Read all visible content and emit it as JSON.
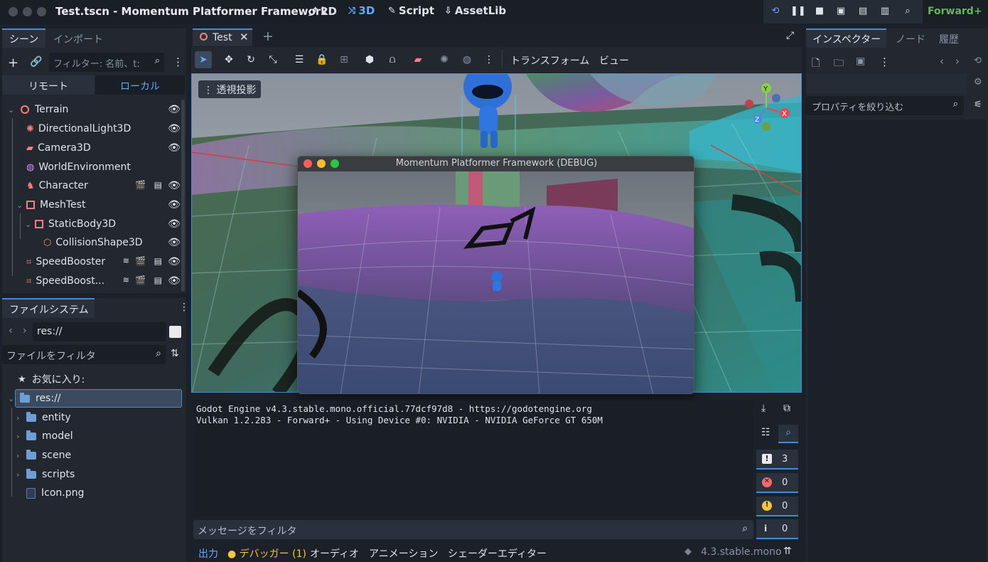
{
  "window": {
    "title": "Test.tscn - Momentum Platformer Framework"
  },
  "modes": [
    {
      "label": "2D",
      "icon": "2d-icon"
    },
    {
      "label": "3D",
      "icon": "3d-icon",
      "active": true
    },
    {
      "label": "Script",
      "icon": "script-icon"
    },
    {
      "label": "AssetLib",
      "icon": "assetlib-icon"
    }
  ],
  "renderer": "Forward+",
  "scene_panel": {
    "tabs": [
      "シーン",
      "インポート"
    ],
    "filter_placeholder": "フィルター: 名前、t:",
    "remote_label": "リモート",
    "local_label": "ローカル",
    "nodes": [
      {
        "name": "Terrain",
        "icon": "node3d-icon",
        "color": "#fc7f7f"
      },
      {
        "name": "DirectionalLight3D",
        "icon": "light-icon",
        "color": "#fc7f7f"
      },
      {
        "name": "Camera3D",
        "icon": "camera-icon",
        "color": "#fc7f7f"
      },
      {
        "name": "WorldEnvironment",
        "icon": "world-environment-icon",
        "color": "#fc7f7f"
      },
      {
        "name": "Character",
        "icon": "character-icon",
        "color": "#fc7f7f"
      },
      {
        "name": "MeshTest",
        "icon": "mesh-icon",
        "color": "#fc7f7f"
      },
      {
        "name": "StaticBody3D",
        "icon": "static-body-icon",
        "color": "#fc7f7f"
      },
      {
        "name": "CollisionShape3D",
        "icon": "collision-shape-icon",
        "color": "#fc7f7f"
      },
      {
        "name": "SpeedBooster",
        "icon": "area-icon",
        "color": "#fc7f7f"
      },
      {
        "name": "SpeedBoost...",
        "icon": "area-icon",
        "color": "#fc7f7f"
      }
    ]
  },
  "filesystem": {
    "tab": "ファイルシステム",
    "path": "res://",
    "filter_placeholder": "ファイルをフィルタ",
    "favorites": "お気に入り:",
    "root": "res://",
    "items": [
      "entity",
      "model",
      "scene",
      "scripts",
      "Icon.png"
    ]
  },
  "editor": {
    "scene_tab": "Test",
    "toolbar_menus": [
      "トランスフォーム",
      "ビュー"
    ],
    "perspective_label": "透視投影"
  },
  "game_window": {
    "title": "Momentum Platformer Framework (DEBUG)"
  },
  "inspector": {
    "tabs": [
      "インスペクター",
      "ノード",
      "履歴"
    ],
    "filter_placeholder": "プロパティを絞り込む"
  },
  "output": {
    "lines": [
      "Godot Engine v4.3.stable.mono.official.77dcf97d8 - https://godotengine.org",
      "Vulkan 1.2.283 - Forward+ - Using Device #0: NVIDIA - NVIDIA GeForce GT 650M"
    ],
    "filter_placeholder": "メッセージをフィルタ",
    "counts": {
      "messages": "3",
      "errors": "0",
      "warnings": "0",
      "info": "0"
    }
  },
  "bottom_tabs": [
    "出力",
    "デバッガー (1)",
    "オーディオ",
    "アニメーション",
    "シェーダーエディター"
  ],
  "version": "4.3.stable.mono",
  "colors": {
    "accent": "#4a8ad0",
    "node_icon": "#fc7f7f",
    "debugger": "#f5c542",
    "renderer": "#5fb95a"
  }
}
